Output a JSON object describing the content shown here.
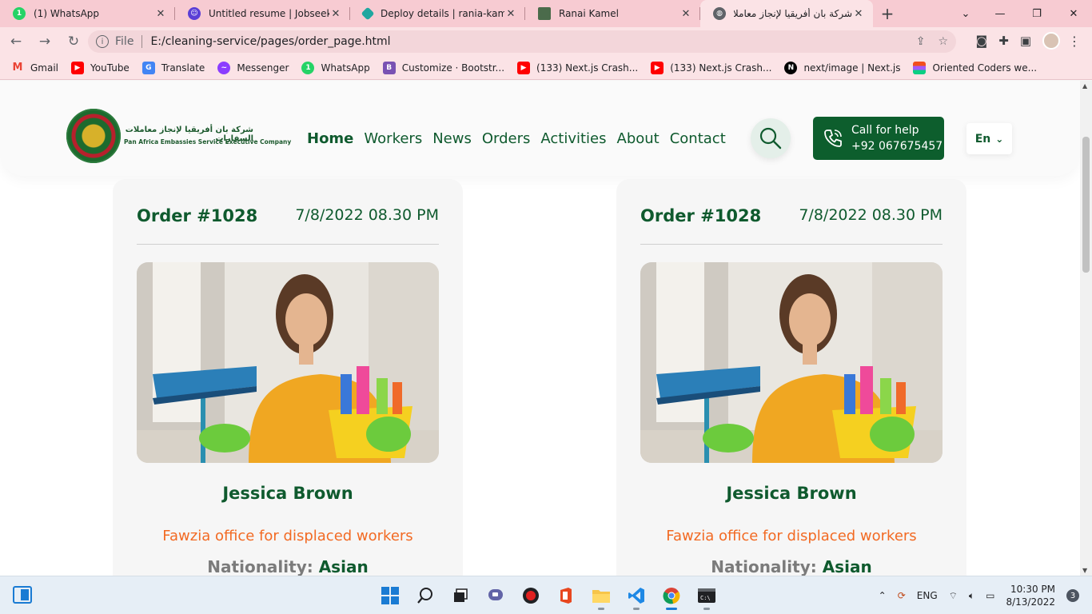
{
  "browser": {
    "tabs": [
      {
        "title": "(1) WhatsApp",
        "icon": "whatsapp-icon",
        "color": "#25d366"
      },
      {
        "title": "Untitled resume | Jobseeker",
        "icon": "jobseeker-icon",
        "color": "#5a3fd6"
      },
      {
        "title": "Deploy details | rania-kamel-",
        "icon": "netlify-icon",
        "color": "#20a7a0"
      },
      {
        "title": "Ranai Kamel",
        "icon": "portfolio-icon",
        "color": "#4b6b4b"
      },
      {
        "title": "شركة بان أفريقيا لإنجاز معاملات",
        "icon": "globe-icon",
        "color": "#5f6368"
      }
    ],
    "new_tab": "+",
    "address": {
      "scheme": "File",
      "url": "E:/cleaning-service/pages/order_page.html"
    },
    "bookmarks": [
      {
        "label": "Gmail",
        "icon": "gmail-icon",
        "color": "#ea4335"
      },
      {
        "label": "YouTube",
        "icon": "youtube-icon",
        "color": "#ff0000"
      },
      {
        "label": "Translate",
        "icon": "translate-icon",
        "color": "#4285f4"
      },
      {
        "label": "Messenger",
        "icon": "messenger-icon",
        "color": "#8b3dff"
      },
      {
        "label": "WhatsApp",
        "icon": "whatsapp-icon",
        "color": "#25d366"
      },
      {
        "label": "Customize · Bootstr...",
        "icon": "bootstrap-icon",
        "color": "#7952b3"
      },
      {
        "label": "(133) Next.js Crash...",
        "icon": "youtube-icon",
        "color": "#ff0000"
      },
      {
        "label": "(133) Next.js Crash...",
        "icon": "youtube-icon",
        "color": "#ff0000"
      },
      {
        "label": "next/image | Next.js",
        "icon": "nextjs-icon",
        "color": "#000000"
      },
      {
        "label": "Oriented Coders we...",
        "icon": "figma-icon",
        "color": "#f24e1e"
      }
    ]
  },
  "site": {
    "logo_ar": "شركة بان أفريقيا لإنجاز معاملات السفارات",
    "logo_en": "Pan Africa Embassies Service Executive Company",
    "nav": [
      "Home",
      "Workers",
      "News",
      "Orders",
      "Activities",
      "About",
      "Contact"
    ],
    "call": {
      "label": "Call for help",
      "phone": "+92 067675457"
    },
    "lang": "En",
    "accent": "#0d5e2d"
  },
  "orders": [
    {
      "id": "Order #1028",
      "date": "7/8/2022 08.30 PM",
      "name": "Jessica Brown",
      "office": "Fawzia office for displaced workers",
      "nationality_label": "Nationality:",
      "nationality": "Asian"
    },
    {
      "id": "Order #1028",
      "date": "7/8/2022 08.30 PM",
      "name": "Jessica Brown",
      "office": "Fawzia office for displaced workers",
      "nationality_label": "Nationality:",
      "nationality": "Asian"
    }
  ],
  "taskbar": {
    "lang": "ENG",
    "time": "10:30 PM",
    "date": "8/13/2022",
    "notifications": "3"
  }
}
